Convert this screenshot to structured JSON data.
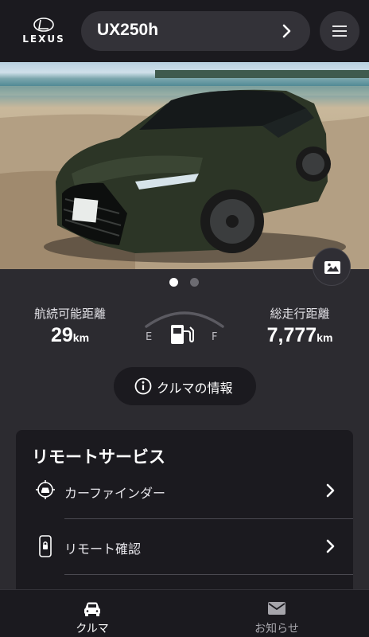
{
  "header": {
    "brand": "LEXUS",
    "model": "UX250h"
  },
  "vehicle_photo": {
    "description_icon": "car-photo",
    "carousel_pages": 2,
    "active_page": 1
  },
  "stats": {
    "range_label": "航続可能距離",
    "range_value": "29",
    "range_unit": "km",
    "fuel_empty": "E",
    "fuel_full": "F",
    "fuel_level": 0.0,
    "odometer_label": "総走行距離",
    "odometer_value": "7,777",
    "odometer_unit": "km"
  },
  "info_button": {
    "label": "クルマの情報"
  },
  "remote": {
    "title": "リモートサービス",
    "items": [
      {
        "label": "カーファインダー",
        "icon": "car-finder-icon"
      },
      {
        "label": "リモート確認",
        "icon": "remote-check-icon"
      }
    ]
  },
  "tabs": [
    {
      "label": "クルマ",
      "icon": "car-icon",
      "active": true
    },
    {
      "label": "お知らせ",
      "icon": "mail-icon",
      "active": false
    }
  ],
  "colors": {
    "background": "#2c2b30",
    "header": "#1b1a1f",
    "pill": "#333238",
    "accent": "#ffffff"
  }
}
